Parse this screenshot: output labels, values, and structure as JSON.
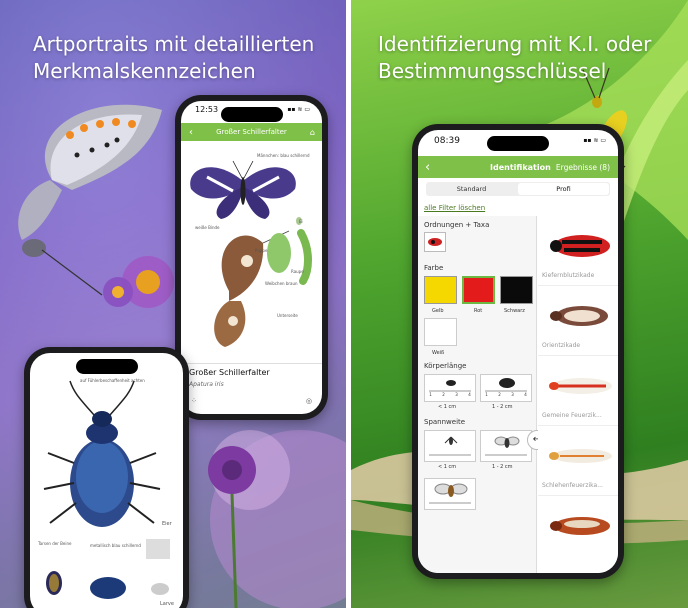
{
  "left_panel": {
    "headline_line1": "Artportraits mit detaillierten",
    "headline_line2": "Merkmalskennzeichen",
    "phone_top": {
      "time": "12:53",
      "status_icons": "▪▪ ≋ ▭",
      "title": "Großer Schillerfalter",
      "captions": {
        "male_wings": "Männchen: blau schillernd",
        "white_band": "weiße Binde",
        "pupa": "Puppe",
        "caterpillar": "Raupe",
        "egg": "Ei",
        "female": "Weibchen braun",
        "underside": "Unterseite"
      },
      "species_name": "Großer Schillerfalter",
      "latin_name": "Apatura iris",
      "bottom_left_icon": "footprint-icon",
      "bottom_right_icon": "bike-icon"
    },
    "phone_bottom": {
      "captions": {
        "antennae": "auf Fühlerbeschaffenheit achten",
        "legs": "Tarsen der Beine",
        "coloring": "metallisch blau schillernd",
        "egg": "Eier",
        "larva": "Larve"
      }
    }
  },
  "right_panel": {
    "headline_line1": "Identifizierung mit K.I. oder",
    "headline_line2": "Bestimmungsschlüssel",
    "phone": {
      "time": "08:39",
      "status_icons": "▪▪ ≋ ▭",
      "nav_back": "‹",
      "nav_title": "Identifikation",
      "nav_results": "Ergebnisse (8)",
      "seg_standard": "Standard",
      "seg_profi": "Profi",
      "clear_filters": "alle Filter löschen",
      "section_orders": "Ordnungen + Taxa",
      "section_color": "Farbe",
      "colors": [
        {
          "label": "Gelb",
          "hex": "#f5d800"
        },
        {
          "label": "Rot",
          "hex": "#e31b1b"
        },
        {
          "label": "Schwarz",
          "hex": "#0a0a0a"
        },
        {
          "label": "Weiß",
          "hex": "#ffffff"
        }
      ],
      "section_body_length": "Körperlänge",
      "body_length_options": [
        "< 1 cm",
        "1 - 2 cm"
      ],
      "ruler_ticks": [
        "1",
        "2",
        "3",
        "4"
      ],
      "section_wingspan": "Spannweite",
      "wingspan_options": [
        "< 1 cm",
        "1 - 2 cm"
      ],
      "results": [
        "Kiefernblutzikade",
        "Orientzikade",
        "Gemeine Feuerzik...",
        "Schlehenfeuerzika..."
      ],
      "divider_handle": "↔"
    }
  }
}
